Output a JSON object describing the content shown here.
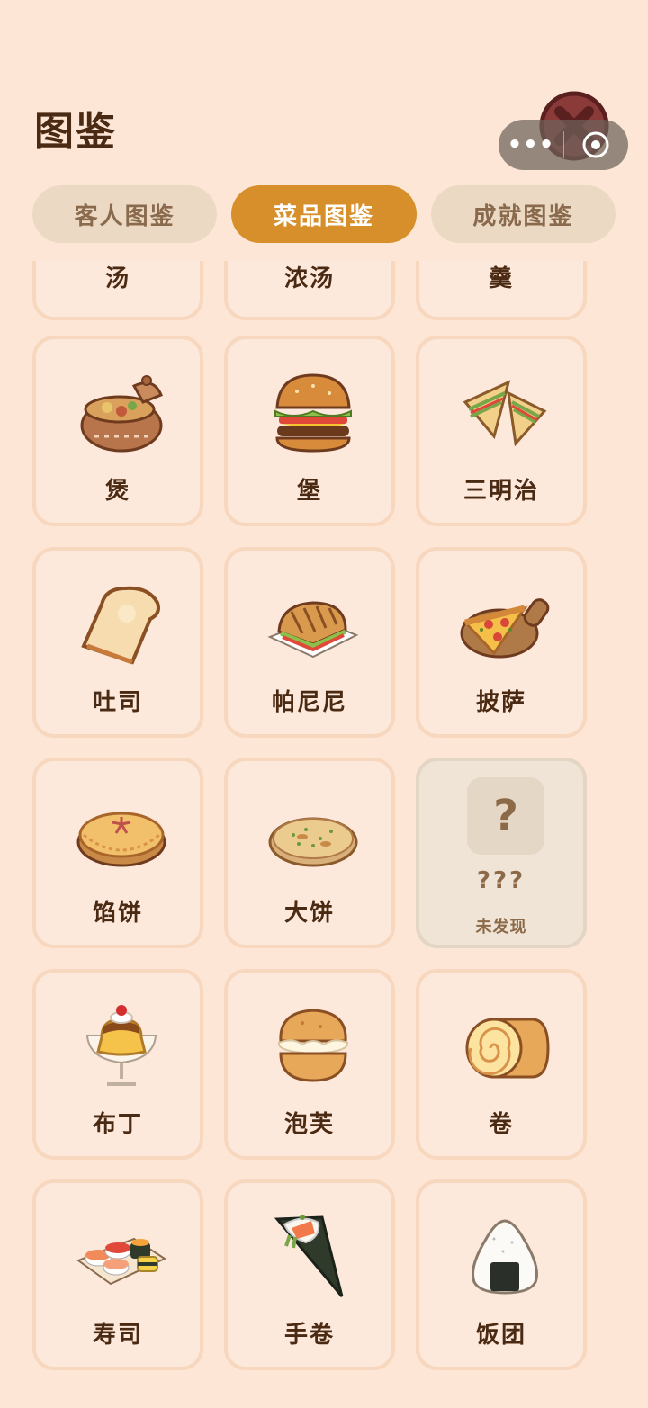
{
  "header": {
    "title": "图鉴"
  },
  "capsule": {
    "more": "•••"
  },
  "tabs": [
    {
      "label": "客人图鉴",
      "active": false
    },
    {
      "label": "菜品图鉴",
      "active": true
    },
    {
      "label": "成就图鉴",
      "active": false
    }
  ],
  "dishes": [
    {
      "label": "汤",
      "icon": "soup-icon"
    },
    {
      "label": "浓汤",
      "icon": "thick-soup-icon"
    },
    {
      "label": "羹",
      "icon": "broth-icon"
    },
    {
      "label": "煲",
      "icon": "clay-pot-icon"
    },
    {
      "label": "堡",
      "icon": "burger-icon"
    },
    {
      "label": "三明治",
      "icon": "sandwich-icon"
    },
    {
      "label": "吐司",
      "icon": "toast-icon"
    },
    {
      "label": "帕尼尼",
      "icon": "panini-icon"
    },
    {
      "label": "披萨",
      "icon": "pizza-icon"
    },
    {
      "label": "馅饼",
      "icon": "pie-icon"
    },
    {
      "label": "大饼",
      "icon": "flatbread-icon"
    },
    {
      "label": "???",
      "status": "未发现",
      "locked": true,
      "icon": "question-icon"
    },
    {
      "label": "布丁",
      "icon": "pudding-icon"
    },
    {
      "label": "泡芙",
      "icon": "cream-puff-icon"
    },
    {
      "label": "卷",
      "icon": "swiss-roll-icon"
    },
    {
      "label": "寿司",
      "icon": "sushi-icon"
    },
    {
      "label": "手卷",
      "icon": "hand-roll-icon"
    },
    {
      "label": "饭团",
      "icon": "rice-ball-icon"
    }
  ],
  "colors": {
    "background": "#fde6d6",
    "accent": "#d68f2a",
    "card_border": "#f7d7bd",
    "text": "#4a2a12"
  }
}
